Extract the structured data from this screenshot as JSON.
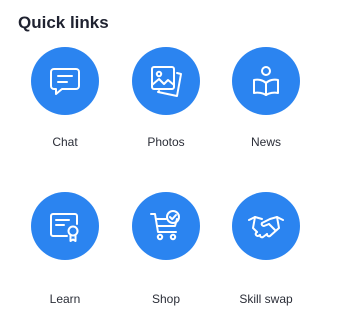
{
  "section_title": "Quick links",
  "accent_color": "#2b84f0",
  "links": [
    {
      "label": "Chat",
      "icon": "chat-bubble-icon"
    },
    {
      "label": "Photos",
      "icon": "photos-icon"
    },
    {
      "label": "News",
      "icon": "reader-book-icon"
    },
    {
      "label": "Learn",
      "icon": "certificate-icon"
    },
    {
      "label": "Shop",
      "icon": "shopping-cart-icon"
    },
    {
      "label": "Skill swap",
      "icon": "handshake-icon"
    }
  ]
}
